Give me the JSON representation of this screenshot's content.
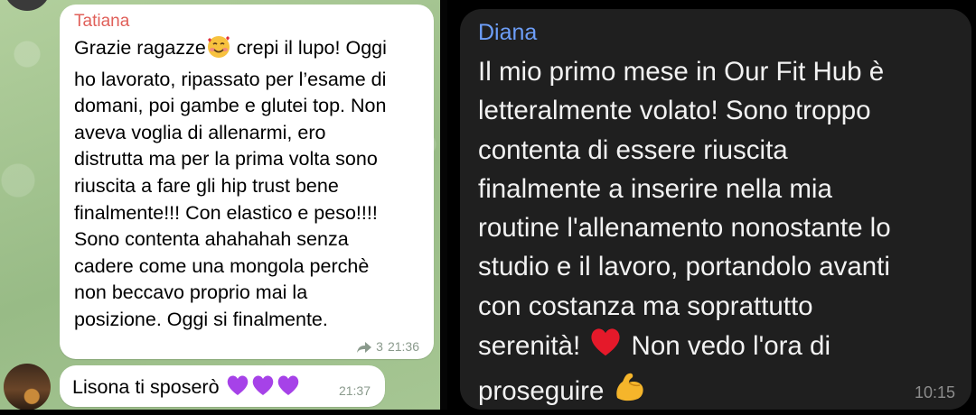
{
  "left_chat": {
    "message1": {
      "sender": "Tatiana",
      "text_part1": "Grazie ragazze",
      "text_part2": " crepi il lupo! Oggi\nho lavorato, ripassato per l’esame di\ndomani, poi gambe e glutei top. Non\naveva voglia di allenarmi, ero\ndistrutta ma per la prima volta sono\nriuscita a fare gli hip trust bene\nfinalmente!!! Con elastico e peso!!!!\nSono contenta ahahahah senza\ncadere come una mongola perchè\nnon beccavo proprio mai la\nposizione. Oggi si finalmente.",
      "forward_count": "3",
      "time": "21:36"
    },
    "message2": {
      "text": "Lisona ti sposerò ",
      "time": "21:37"
    }
  },
  "right_chat": {
    "message": {
      "sender": "Diana",
      "text_part1": "Il mio primo mese in Our Fit Hub è\nletteralmente volato! Sono troppo\ncontenta di essere riuscita\nfinalmente a inserire nella mia\nroutine l'allenamento nonostante lo\nstudio e il lavoro, portandolo avanti\ncon costanza ma soprattutto\nserenità! ",
      "text_part2": " Non vedo l'ora di\nproseguire ",
      "time": "10:15"
    }
  },
  "colors": {
    "left_sender": "#e0605a",
    "right_sender": "#6d9ef8",
    "chat_bg_light": "#a9c99a",
    "bubble_dark": "#1f1f1f"
  }
}
